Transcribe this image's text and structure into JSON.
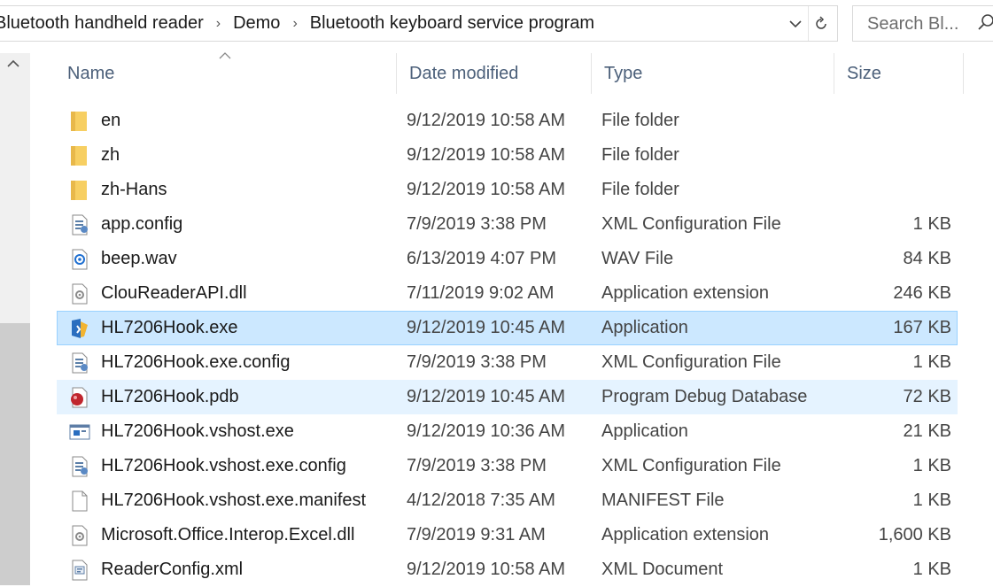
{
  "address_bar": {
    "breadcrumbs": [
      "Bluetooth handheld reader",
      "Demo",
      "Bluetooth keyboard service program"
    ],
    "separator": "›",
    "dropdown_icon": "chevron-down-icon",
    "refresh_icon": "refresh-icon"
  },
  "search": {
    "placeholder": "Search Bl...",
    "icon": "search-icon"
  },
  "columns": {
    "name": "Name",
    "date": "Date modified",
    "type": "Type",
    "size": "Size"
  },
  "files": [
    {
      "name": "en",
      "date": "9/12/2019 10:58 AM",
      "type": "File folder",
      "size": "",
      "icon": "folder-icon",
      "state": ""
    },
    {
      "name": "zh",
      "date": "9/12/2019 10:58 AM",
      "type": "File folder",
      "size": "",
      "icon": "folder-icon",
      "state": ""
    },
    {
      "name": "zh-Hans",
      "date": "9/12/2019 10:58 AM",
      "type": "File folder",
      "size": "",
      "icon": "folder-icon",
      "state": ""
    },
    {
      "name": "app.config",
      "date": "7/9/2019 3:38 PM",
      "type": "XML Configuration File",
      "size": "1 KB",
      "icon": "config-file-icon",
      "state": ""
    },
    {
      "name": "beep.wav",
      "date": "6/13/2019 4:07 PM",
      "type": "WAV File",
      "size": "84 KB",
      "icon": "audio-file-icon",
      "state": ""
    },
    {
      "name": "ClouReaderAPI.dll",
      "date": "7/11/2019 9:02 AM",
      "type": "Application extension",
      "size": "246 KB",
      "icon": "dll-file-icon",
      "state": ""
    },
    {
      "name": "HL7206Hook.exe",
      "date": "9/12/2019 10:45 AM",
      "type": "Application",
      "size": "167 KB",
      "icon": "app-exe-icon",
      "state": "selected"
    },
    {
      "name": "HL7206Hook.exe.config",
      "date": "7/9/2019 3:38 PM",
      "type": "XML Configuration File",
      "size": "1 KB",
      "icon": "config-file-icon",
      "state": ""
    },
    {
      "name": "HL7206Hook.pdb",
      "date": "9/12/2019 10:45 AM",
      "type": "Program Debug Database",
      "size": "72 KB",
      "icon": "pdb-file-icon",
      "state": "hover"
    },
    {
      "name": "HL7206Hook.vshost.exe",
      "date": "9/12/2019 10:36 AM",
      "type": "Application",
      "size": "21 KB",
      "icon": "window-exe-icon",
      "state": ""
    },
    {
      "name": "HL7206Hook.vshost.exe.config",
      "date": "7/9/2019 3:38 PM",
      "type": "XML Configuration File",
      "size": "1 KB",
      "icon": "config-file-icon",
      "state": ""
    },
    {
      "name": "HL7206Hook.vshost.exe.manifest",
      "date": "4/12/2018 7:35 AM",
      "type": "MANIFEST File",
      "size": "1 KB",
      "icon": "blank-file-icon",
      "state": ""
    },
    {
      "name": "Microsoft.Office.Interop.Excel.dll",
      "date": "7/9/2019 9:31 AM",
      "type": "Application extension",
      "size": "1,600 KB",
      "icon": "dll-file-icon",
      "state": ""
    },
    {
      "name": "ReaderConfig.xml",
      "date": "9/12/2019 10:58 AM",
      "type": "XML Document",
      "size": "1 KB",
      "icon": "xml-file-icon",
      "state": ""
    }
  ],
  "colors": {
    "selected_bg": "#cce8ff",
    "selected_border": "#99d1ff",
    "hover_bg": "#e5f3ff",
    "header_text": "#4c607a",
    "folder": "#f7cf62"
  }
}
